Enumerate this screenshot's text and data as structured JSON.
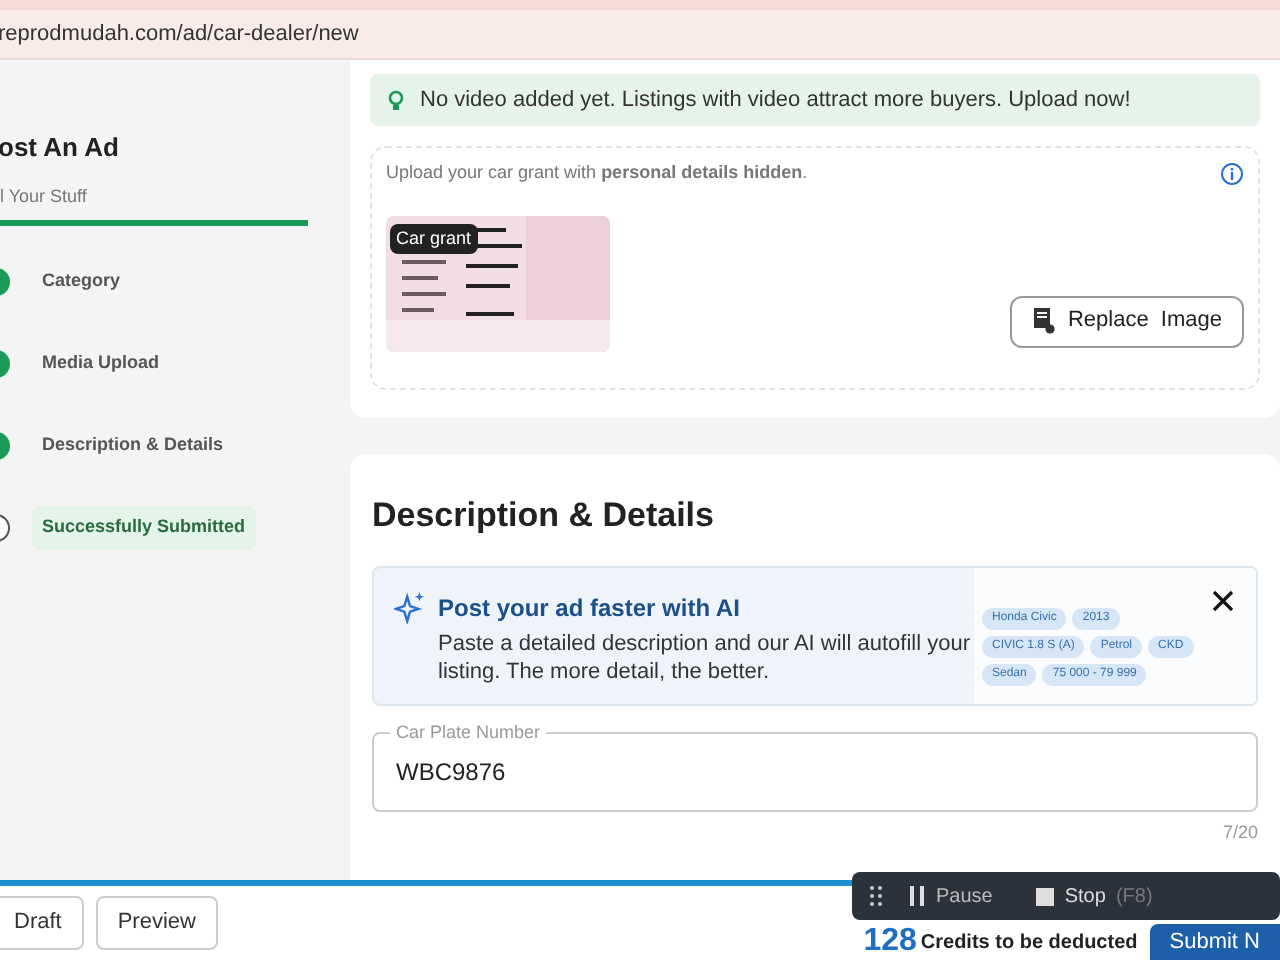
{
  "browser": {
    "url": "reprodmudah.com/ad/car-dealer/new"
  },
  "sidebar": {
    "title": "ost An Ad",
    "subtitle": "l Your Stuff",
    "progress": {
      "level": 1
    },
    "steps": [
      {
        "label": "Category",
        "done": true,
        "selected": false
      },
      {
        "label": "Media Upload",
        "done": true,
        "selected": false
      },
      {
        "label": "Description & Details",
        "done": true,
        "selected": false
      },
      {
        "label": "Successfully Submitted",
        "done": false,
        "selected": true
      }
    ]
  },
  "video_notice": "No video added yet. Listings with video attract more buyers. Upload now!",
  "car_grant": {
    "instruction": "Upload your car grant with **personal details hidden**.",
    "tag": "Car grant",
    "replace_button": "Replace  Image"
  },
  "description": {
    "heading": "Description & Details",
    "ai_banner": {
      "title": "Post your ad faster with AI",
      "text": "Paste a detailed description and our AI will autofill your listing. The more detail, the better.",
      "chips": [
        "Honda Civic",
        "2013",
        "CIVIC 1.8 S (A)",
        "Petrol",
        "CKD",
        "Sedan",
        "75 000 - 79 999"
      ]
    },
    "plate_field": {
      "label": "Car Plate Number",
      "value": "WBC9876",
      "counter": "7/20"
    }
  },
  "footer": {
    "buttons": [
      "Draft",
      "Preview"
    ],
    "credits": "128",
    "credits_text": "Credits to be deducted",
    "submit": "Submit N"
  },
  "recorder": {
    "pause": "Pause",
    "stop": "Stop",
    "shortcut": "(F8)"
  }
}
